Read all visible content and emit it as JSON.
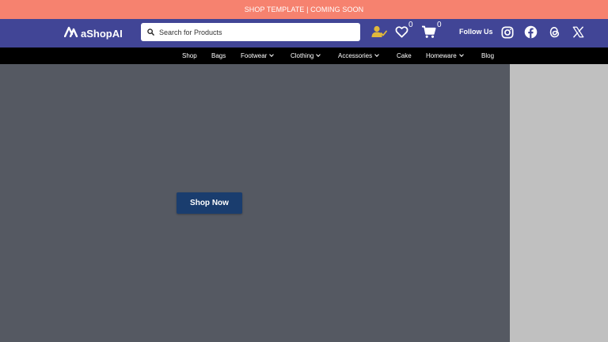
{
  "announcement": {
    "text": "SHOP TEMPLATE | COMING SOON"
  },
  "header": {
    "logo_text": "aShopAI",
    "search_placeholder": "Search for Products",
    "wishlist_count": "0",
    "cart_count": "0",
    "follow_label": "Follow Us",
    "social_icons": [
      "instagram-icon",
      "facebook-icon",
      "threads-icon",
      "x-icon"
    ]
  },
  "nav": {
    "items": [
      {
        "label": "Shop",
        "dropdown": false
      },
      {
        "label": "Bags",
        "dropdown": false
      },
      {
        "label": "Footwear",
        "dropdown": true
      },
      {
        "label": "Clothing",
        "dropdown": true
      },
      {
        "label": "Accessories",
        "dropdown": true
      },
      {
        "label": "Cake",
        "dropdown": false
      },
      {
        "label": "Homeware",
        "dropdown": true
      },
      {
        "label": "Blog",
        "dropdown": false
      }
    ]
  },
  "hero": {
    "cta_label": "Shop Now"
  },
  "colors": {
    "announcement_bg": "#f6826f",
    "header_bg": "#414596",
    "nav_bg": "#000000",
    "hero_bg": "#555962",
    "cta_bg": "#1a3d6e",
    "user_icon": "#e0b83b",
    "side_panel": "#c0c0c0"
  }
}
